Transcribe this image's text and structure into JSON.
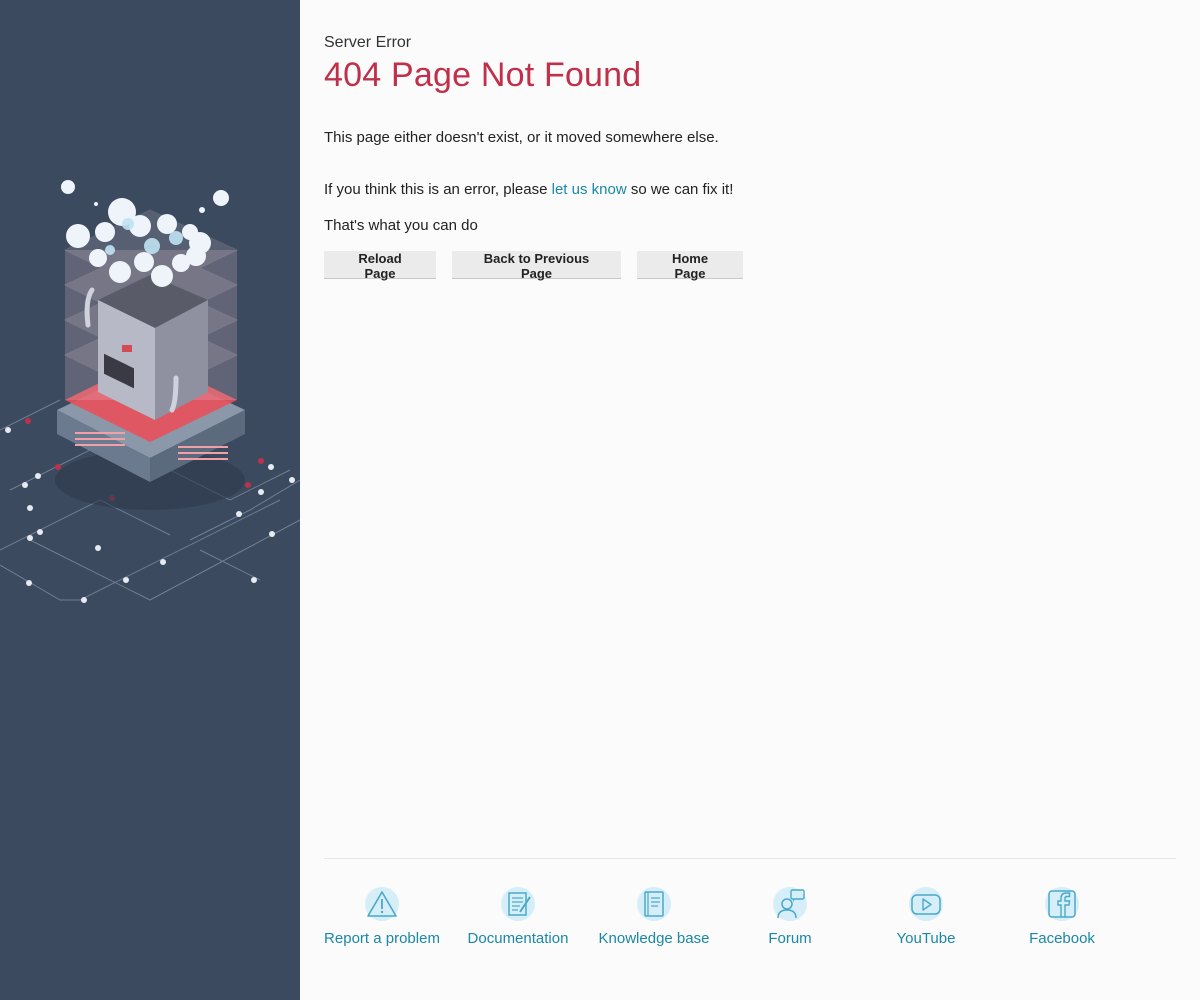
{
  "header": {
    "eyebrow": "Server Error",
    "title": "404 Page Not Found"
  },
  "body": {
    "line1": "This page either doesn't exist, or it moved somewhere else.",
    "line2_before": "If you think this is an error, please ",
    "line2_link": "let us know",
    "line2_after": " so we can fix it!",
    "line3": "That's what you can do"
  },
  "actions": {
    "reload": "Reload Page",
    "back": "Back to Previous Page",
    "home": "Home Page"
  },
  "footer": {
    "items": [
      {
        "label": "Report a problem",
        "icon": "warning-icon"
      },
      {
        "label": "Documentation",
        "icon": "document-icon"
      },
      {
        "label": "Knowledge base",
        "icon": "book-icon"
      },
      {
        "label": "Forum",
        "icon": "forum-icon"
      },
      {
        "label": "YouTube",
        "icon": "youtube-icon"
      },
      {
        "label": "Facebook",
        "icon": "facebook-icon"
      }
    ]
  },
  "colors": {
    "sidebar_bg": "#3b4a5f",
    "title_red": "#c0304a",
    "link_teal": "#1a88a6",
    "icon_bg": "#d6eef8"
  }
}
